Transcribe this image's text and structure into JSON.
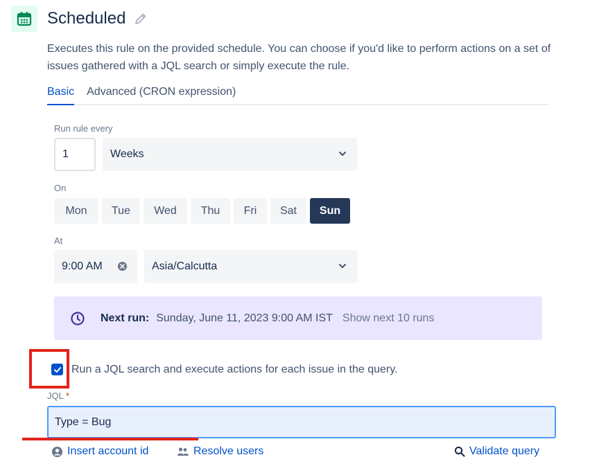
{
  "trigger": {
    "title": "Scheduled",
    "description": "Executes this rule on the provided schedule. You can choose if you'd like to perform actions on a set of issues gathered with a JQL search or simply execute the rule.",
    "icon": "calendar-icon",
    "accent": "#00875a"
  },
  "tabs": [
    {
      "label": "Basic",
      "active": true
    },
    {
      "label": "Advanced (CRON expression)",
      "active": false
    }
  ],
  "interval": {
    "label": "Run rule every",
    "value": "1",
    "unit": "Weeks"
  },
  "on": {
    "label": "On",
    "days": [
      {
        "label": "Mon",
        "selected": false
      },
      {
        "label": "Tue",
        "selected": false
      },
      {
        "label": "Wed",
        "selected": false
      },
      {
        "label": "Thu",
        "selected": false
      },
      {
        "label": "Fri",
        "selected": false
      },
      {
        "label": "Sat",
        "selected": false
      },
      {
        "label": "Sun",
        "selected": true
      }
    ]
  },
  "at": {
    "label": "At",
    "time": "9:00 AM",
    "timezone": "Asia/Calcutta"
  },
  "next_run": {
    "label": "Next run:",
    "value": "Sunday, June 11, 2023 9:00 AM IST",
    "link": "Show next 10 runs"
  },
  "jql_option": {
    "checked": true,
    "label": "Run a JQL search and execute actions for each issue in the query."
  },
  "jql": {
    "label": "JQL",
    "required_marker": "*",
    "value": "Type = Bug"
  },
  "links": {
    "insert_account_id": "Insert account id",
    "resolve_users": "Resolve users",
    "validate_query": "Validate query"
  },
  "colors": {
    "primary": "#0052cc",
    "selected_day": "#253858",
    "next_run_bg": "#eae6ff",
    "annotation": "#e2231a"
  }
}
